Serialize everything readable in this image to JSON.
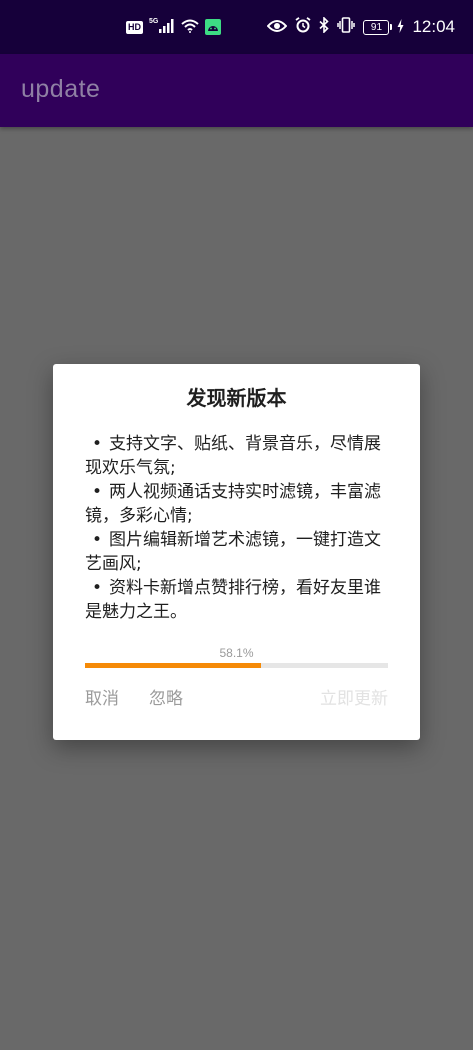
{
  "status_bar": {
    "hd_label": "HD",
    "network_label": "5G",
    "battery_level": "91",
    "time": "12:04",
    "icons": [
      "hd-icon",
      "signal-icon",
      "wifi-icon",
      "android-icon",
      "eye-icon",
      "alarm-icon",
      "bluetooth-icon",
      "vibrate-icon",
      "battery-icon",
      "charging-icon"
    ]
  },
  "app_bar": {
    "title": "update"
  },
  "dialog": {
    "title": "发现新版本",
    "changelog": [
      "支持文字、贴纸、背景音乐，尽情展现欢乐气氛;",
      "两人视频通话支持实时滤镜，丰富滤镜，多彩心情;",
      "图片编辑新增艺术滤镜，一键打造文艺画风;",
      "资料卡新增点赞排行榜，看好友里谁是魅力之王。"
    ],
    "progress": {
      "label": "58.1%",
      "value": 0.581
    },
    "buttons": {
      "cancel": "取消",
      "ignore": "忽略",
      "update": "立即更新"
    }
  },
  "colors": {
    "status_bar_bg": "#16003a",
    "app_bar_bg": "#30005a",
    "scrim": "#696969",
    "progress_fill": "#f58a07",
    "progress_track": "#e6e6e6"
  }
}
